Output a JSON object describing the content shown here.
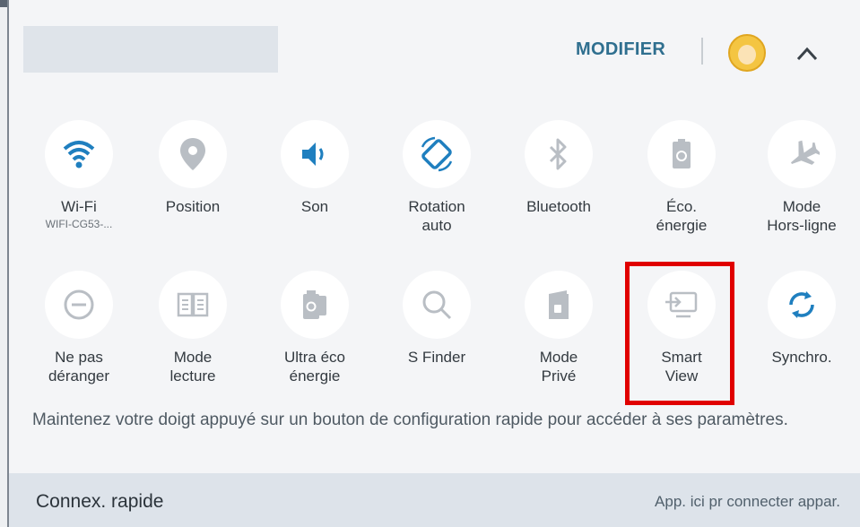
{
  "header": {
    "modifier_label": "MODIFIER"
  },
  "tiles_row1": [
    {
      "label": "Wi-Fi",
      "sub": "WIFI-CG53-...",
      "icon": "wifi-icon"
    },
    {
      "label": "Position",
      "sub": "",
      "icon": "location-pin-icon"
    },
    {
      "label": "Son",
      "sub": "",
      "icon": "speaker-icon"
    },
    {
      "label": "Rotation\nauto",
      "sub": "",
      "icon": "rotation-icon"
    },
    {
      "label": "Bluetooth",
      "sub": "",
      "icon": "bluetooth-icon"
    },
    {
      "label": "Éco.\nénergie",
      "sub": "",
      "icon": "battery-saver-icon"
    },
    {
      "label": "Mode\nHors-ligne",
      "sub": "",
      "icon": "airplane-icon"
    }
  ],
  "tiles_row2": [
    {
      "label": "Ne pas\ndéranger",
      "icon": "do-not-disturb-icon"
    },
    {
      "label": "Mode\nlecture",
      "icon": "book-icon"
    },
    {
      "label": "Ultra éco\nénergie",
      "icon": "ultra-power-saving-icon"
    },
    {
      "label": "S Finder",
      "icon": "search-icon"
    },
    {
      "label": "Mode\nPrivé",
      "icon": "private-mode-icon"
    },
    {
      "label": "Smart\nView",
      "icon": "screen-cast-icon"
    },
    {
      "label": "Synchro.",
      "icon": "sync-icon"
    }
  ],
  "hint": "Maintenez votre doigt appuyé sur un bouton de configuration rapide pour accéder à ses paramètres.",
  "quick_connect": {
    "title": "Connex. rapide",
    "action": "App. ici pr connecter appar."
  },
  "colors": {
    "accent": "#2f6f8f",
    "icon_active": "#1f7fbf",
    "icon_inactive": "#b9bec4",
    "highlight": "#e00000"
  }
}
